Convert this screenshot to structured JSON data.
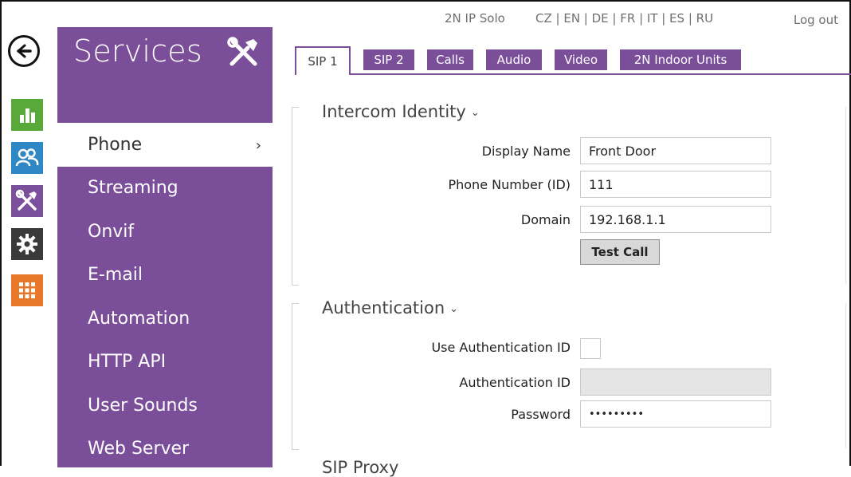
{
  "header": {
    "device_name": "2N IP Solo",
    "languages": "CZ | EN | DE | FR | IT | ES | RU",
    "logout_label": "Log out"
  },
  "rail": {
    "items": [
      {
        "name": "status",
        "icon": "bar-chart-icon",
        "color": "#58a83a"
      },
      {
        "name": "directory",
        "icon": "users-icon",
        "color": "#2f87c5"
      },
      {
        "name": "services",
        "icon": "tools-icon",
        "color": "#7a4f9c"
      },
      {
        "name": "system",
        "icon": "gear-icon",
        "color": "#3a3a3a"
      },
      {
        "name": "apps",
        "icon": "grid-icon",
        "color": "#e7782a"
      }
    ]
  },
  "sidebar": {
    "title": "Services",
    "accent_color": "#7b4e99",
    "items": [
      {
        "label": "Phone",
        "active": true
      },
      {
        "label": "Streaming"
      },
      {
        "label": "Onvif"
      },
      {
        "label": "E-mail"
      },
      {
        "label": "Automation"
      },
      {
        "label": "HTTP API"
      },
      {
        "label": "User Sounds"
      },
      {
        "label": "Web Server"
      }
    ]
  },
  "tabs": [
    {
      "label": "SIP 1",
      "active": true
    },
    {
      "label": "SIP 2"
    },
    {
      "label": "Calls"
    },
    {
      "label": "Audio"
    },
    {
      "label": "Video"
    },
    {
      "label": "2N Indoor Units"
    }
  ],
  "intercom_identity": {
    "title": "Intercom Identity",
    "display_name_label": "Display Name",
    "display_name_value": "Front Door",
    "phone_number_label": "Phone Number (ID)",
    "phone_number_value": "111",
    "domain_label": "Domain",
    "domain_value": "192.168.1.1",
    "test_call_label": "Test Call"
  },
  "authentication": {
    "title": "Authentication",
    "use_auth_id_label": "Use Authentication ID",
    "use_auth_id_checked": false,
    "auth_id_label": "Authentication ID",
    "auth_id_value": "",
    "password_label": "Password",
    "password_value": "•••••••••"
  },
  "next_section": {
    "title": "SIP Proxy"
  }
}
